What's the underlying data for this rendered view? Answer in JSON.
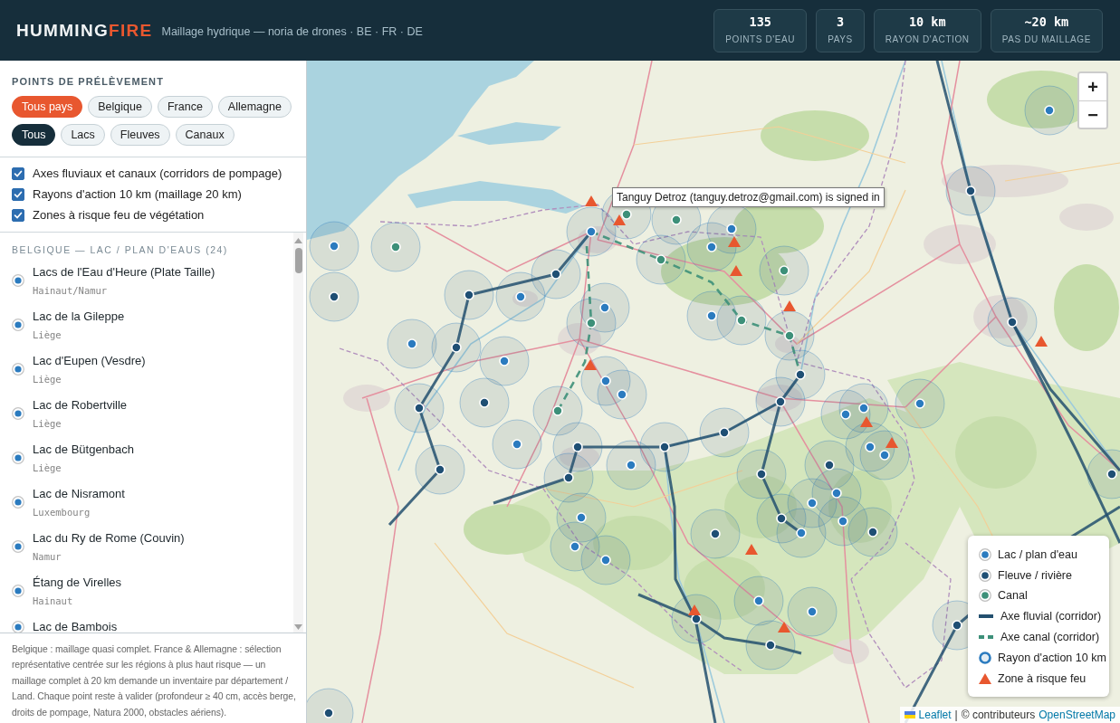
{
  "header": {
    "logo": {
      "text": "HUMMING",
      "accent": "FIRE"
    },
    "subtitle": "Maillage hydrique — noria de drones · BE · FR · DE",
    "stats": [
      {
        "value": "135",
        "label": "POINTS D'EAU"
      },
      {
        "value": "3",
        "label": "PAYS"
      },
      {
        "value": "10 km",
        "label": "RAYON D'ACTION"
      },
      {
        "value": "~20 km",
        "label": "PAS DU MAILLAGE"
      }
    ]
  },
  "sidebar": {
    "title": "POINTS DE PRÉLÈVEMENT",
    "country_filters": [
      {
        "label": "Tous pays",
        "selected": true
      },
      {
        "label": "Belgique",
        "selected": false
      },
      {
        "label": "France",
        "selected": false
      },
      {
        "label": "Allemagne",
        "selected": false
      }
    ],
    "type_filters": [
      {
        "label": "Tous",
        "selected": true
      },
      {
        "label": "Lacs",
        "selected": false
      },
      {
        "label": "Fleuves",
        "selected": false
      },
      {
        "label": "Canaux",
        "selected": false
      }
    ],
    "layers": [
      {
        "label": "Axes fluviaux et canaux (corridors de pompage)",
        "checked": true
      },
      {
        "label": "Rayons d'action 10 km (maillage 20 km)",
        "checked": true
      },
      {
        "label": "Zones à risque feu de végétation",
        "checked": true
      }
    ],
    "list": {
      "heading": "BELGIQUE — LAC / PLAN D'EAUS (24)",
      "items": [
        {
          "name": "Lacs de l'Eau d'Heure (Plate Taille)",
          "region": "Hainaut/Namur"
        },
        {
          "name": "Lac de la Gileppe",
          "region": "Liège"
        },
        {
          "name": "Lac d'Eupen (Vesdre)",
          "region": "Liège"
        },
        {
          "name": "Lac de Robertville",
          "region": "Liège"
        },
        {
          "name": "Lac de Bütgenbach",
          "region": "Liège"
        },
        {
          "name": "Lac de Nisramont",
          "region": "Luxembourg"
        },
        {
          "name": "Lac du Ry de Rome (Couvin)",
          "region": "Namur"
        },
        {
          "name": "Étang de Virelles",
          "region": "Hainaut"
        },
        {
          "name": "Lac de Bambois"
        }
      ]
    },
    "note": "Belgique : maillage quasi complet. France & Allemagne : sélection représentative centrée sur les régions à plus haut risque — un maillage complet à 20 km demande un inventaire par département / Land. Chaque point reste à valider (profondeur ≥ 40 cm, accès berge, droits de pompage, Natura 2000, obstacles aériens)."
  },
  "map": {
    "zoom_controls": [
      "+",
      "−"
    ],
    "tooltip": "Tanguy Detroz (tanguy.detroz@gmail.com) is signed in",
    "legend": [
      {
        "kind": "lake",
        "label": "Lac / plan d'eau",
        "color": "#2b7bbf"
      },
      {
        "kind": "river",
        "label": "Fleuve / rivière",
        "color": "#1f4f74"
      },
      {
        "kind": "canal",
        "label": "Canal",
        "color": "#3d9079"
      },
      {
        "kind": "river_axis",
        "label": "Axe fluvial (corridor)",
        "color": "#23506f"
      },
      {
        "kind": "canal_axis",
        "label": "Axe canal (corridor)",
        "color": "#3d9079"
      },
      {
        "kind": "radius",
        "label": "Rayon d'action 10 km",
        "color": "#2b7bbf"
      },
      {
        "kind": "fire",
        "label": "Zone à risque feu",
        "color": "#e8572f"
      }
    ],
    "attribution": {
      "library": "Leaflet",
      "separator": "|",
      "text": "© contributeurs",
      "source": "OpenStreetMap"
    }
  }
}
